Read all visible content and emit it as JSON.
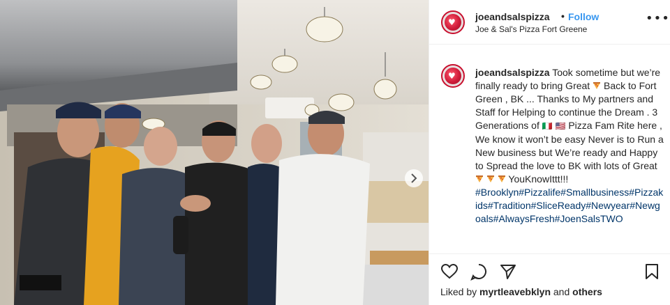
{
  "post": {
    "username": "joeandsalspizza",
    "separator": "•",
    "follow_label": "Follow",
    "location": "Joe & Sal's Pizza Fort Greene",
    "more_label": "•••"
  },
  "caption": {
    "username": "joeandsalspizza",
    "part1": "Took sometime but we’re finally ready to bring Great ",
    "part2": " Back to Fort Green , BK ... Thanks to My partners and Staff for Helping to continue the Dream . 3 Generations of ",
    "flags": "🇮🇹 🇺🇸",
    "part3": " Pizza Fam Rite here , We know it won’t be easy Never is to Run a New business but We’re ready and Happy to Spread the love to BK with lots of Great ",
    "part4": " YouKnowIttt!!!",
    "hashtags": "#Brooklyn#Pizzalife#Smallbusiness#Pizzakids#Tradition#SliceReady#Newyear#Newgoals#AlwaysFresh#JoenSalsTWO"
  },
  "icons": {
    "like": "heart-icon",
    "comment": "comment-icon",
    "share": "share-icon",
    "save": "bookmark-icon",
    "carousel": "chevron-right-icon"
  },
  "likes": {
    "prefix": "Liked by ",
    "user": "myrtleavebklyn",
    "and": " and ",
    "others": "others"
  },
  "colors": {
    "follow": "#3897f0",
    "hashtag": "#003569",
    "brand": "#c8102e",
    "text": "#262626"
  }
}
